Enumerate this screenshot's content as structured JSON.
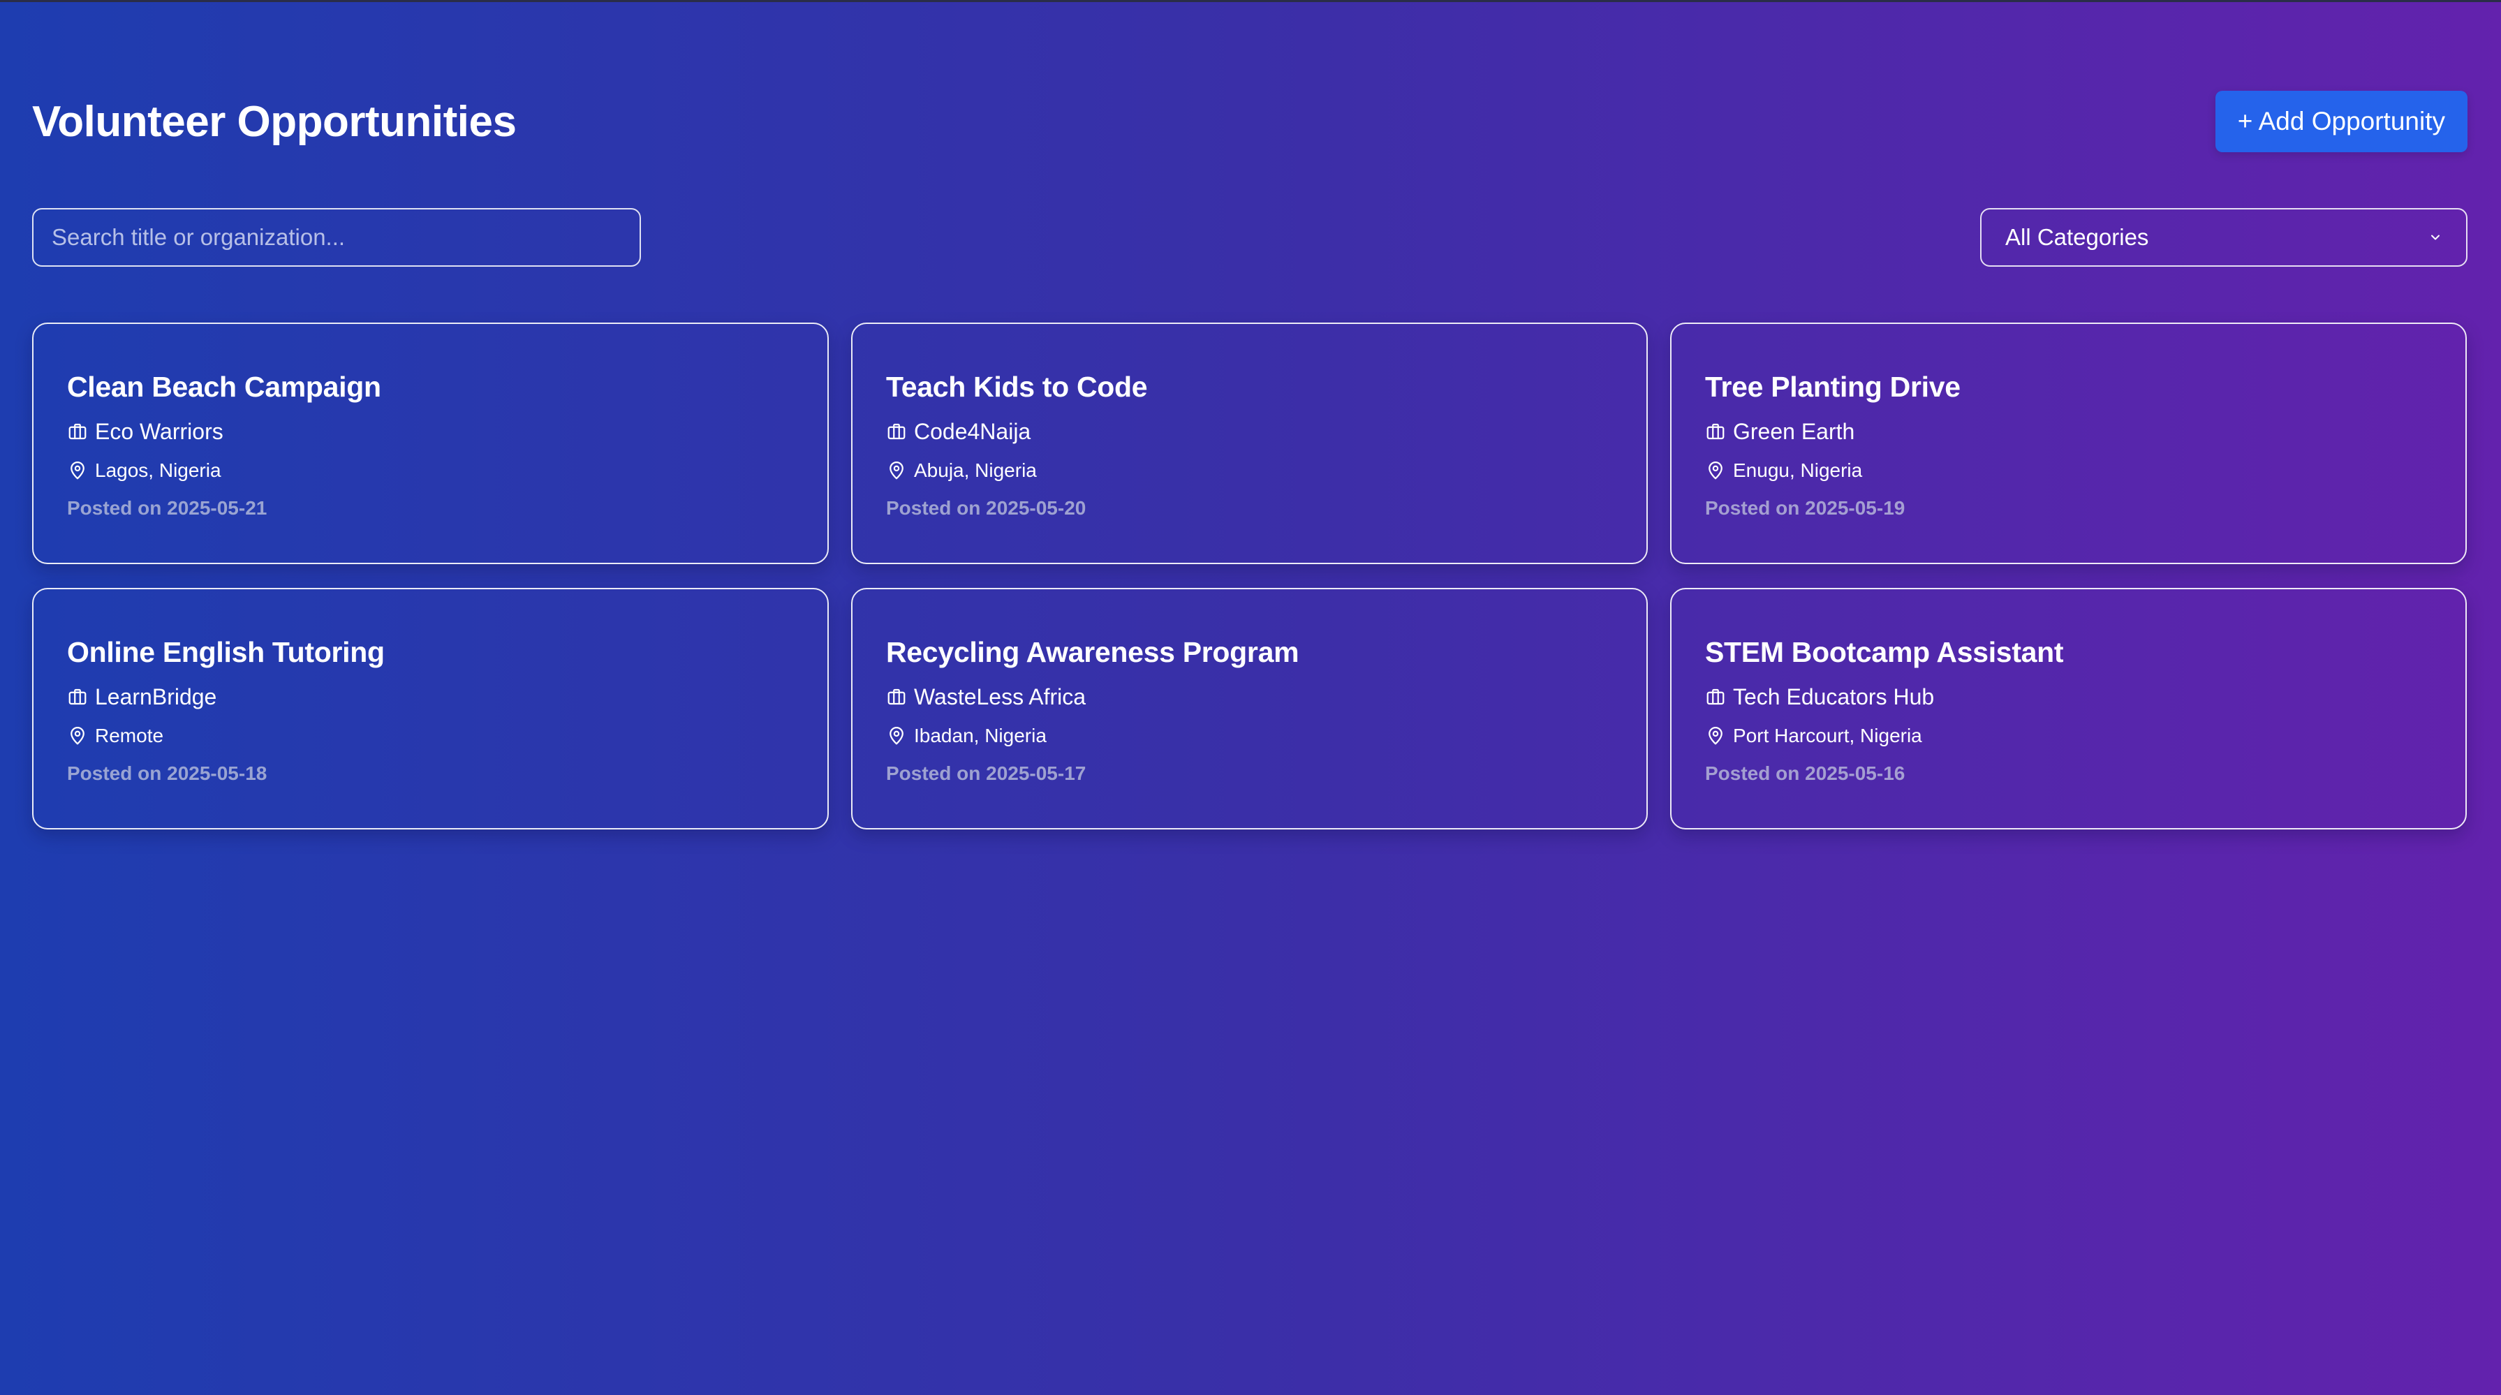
{
  "header": {
    "title": "Volunteer Opportunities",
    "add_button_label": "+ Add Opportunity"
  },
  "filters": {
    "search_placeholder": "Search title or organization...",
    "search_value": "",
    "category_selected": "All Categories"
  },
  "opportunities": [
    {
      "title": "Clean Beach Campaign",
      "organization": "Eco Warriors",
      "location": "Lagos, Nigeria",
      "posted": "Posted on 2025-05-21"
    },
    {
      "title": "Teach Kids to Code",
      "organization": "Code4Naija",
      "location": "Abuja, Nigeria",
      "posted": "Posted on 2025-05-20"
    },
    {
      "title": "Tree Planting Drive",
      "organization": "Green Earth",
      "location": "Enugu, Nigeria",
      "posted": "Posted on 2025-05-19"
    },
    {
      "title": "Online English Tutoring",
      "organization": "LearnBridge",
      "location": "Remote",
      "posted": "Posted on 2025-05-18"
    },
    {
      "title": "Recycling Awareness Program",
      "organization": "WasteLess Africa",
      "location": "Ibadan, Nigeria",
      "posted": "Posted on 2025-05-17"
    },
    {
      "title": "STEM Bootcamp Assistant",
      "organization": "Tech Educators Hub",
      "location": "Port Harcourt, Nigeria",
      "posted": "Posted on 2025-05-16"
    }
  ],
  "icons": {
    "organization": "briefcase-icon",
    "location": "map-pin-icon",
    "select": "chevron-down-icon"
  },
  "colors": {
    "gradient_start": "#1e3db0",
    "gradient_end": "#6322ad",
    "button": "#2563eb"
  }
}
